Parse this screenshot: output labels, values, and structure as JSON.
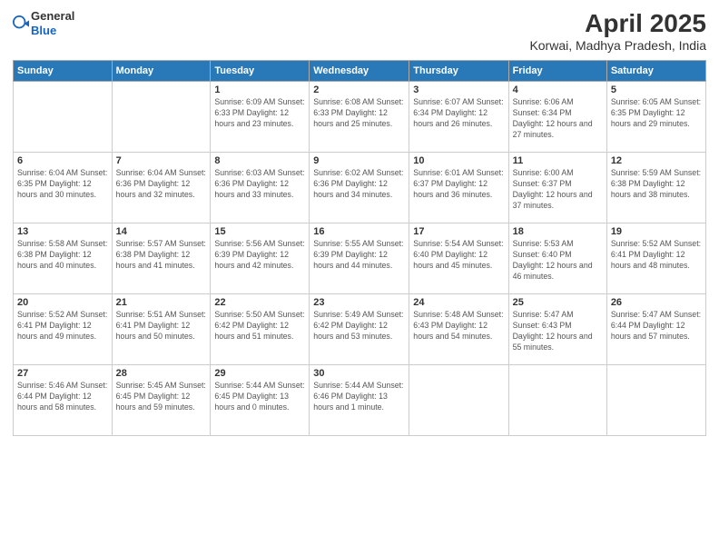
{
  "header": {
    "logo_general": "General",
    "logo_blue": "Blue",
    "month_title": "April 2025",
    "location": "Korwai, Madhya Pradesh, India"
  },
  "days_of_week": [
    "Sunday",
    "Monday",
    "Tuesday",
    "Wednesday",
    "Thursday",
    "Friday",
    "Saturday"
  ],
  "weeks": [
    [
      {
        "day": "",
        "info": ""
      },
      {
        "day": "",
        "info": ""
      },
      {
        "day": "1",
        "info": "Sunrise: 6:09 AM\nSunset: 6:33 PM\nDaylight: 12 hours and 23 minutes."
      },
      {
        "day": "2",
        "info": "Sunrise: 6:08 AM\nSunset: 6:33 PM\nDaylight: 12 hours and 25 minutes."
      },
      {
        "day": "3",
        "info": "Sunrise: 6:07 AM\nSunset: 6:34 PM\nDaylight: 12 hours and 26 minutes."
      },
      {
        "day": "4",
        "info": "Sunrise: 6:06 AM\nSunset: 6:34 PM\nDaylight: 12 hours and 27 minutes."
      },
      {
        "day": "5",
        "info": "Sunrise: 6:05 AM\nSunset: 6:35 PM\nDaylight: 12 hours and 29 minutes."
      }
    ],
    [
      {
        "day": "6",
        "info": "Sunrise: 6:04 AM\nSunset: 6:35 PM\nDaylight: 12 hours and 30 minutes."
      },
      {
        "day": "7",
        "info": "Sunrise: 6:04 AM\nSunset: 6:36 PM\nDaylight: 12 hours and 32 minutes."
      },
      {
        "day": "8",
        "info": "Sunrise: 6:03 AM\nSunset: 6:36 PM\nDaylight: 12 hours and 33 minutes."
      },
      {
        "day": "9",
        "info": "Sunrise: 6:02 AM\nSunset: 6:36 PM\nDaylight: 12 hours and 34 minutes."
      },
      {
        "day": "10",
        "info": "Sunrise: 6:01 AM\nSunset: 6:37 PM\nDaylight: 12 hours and 36 minutes."
      },
      {
        "day": "11",
        "info": "Sunrise: 6:00 AM\nSunset: 6:37 PM\nDaylight: 12 hours and 37 minutes."
      },
      {
        "day": "12",
        "info": "Sunrise: 5:59 AM\nSunset: 6:38 PM\nDaylight: 12 hours and 38 minutes."
      }
    ],
    [
      {
        "day": "13",
        "info": "Sunrise: 5:58 AM\nSunset: 6:38 PM\nDaylight: 12 hours and 40 minutes."
      },
      {
        "day": "14",
        "info": "Sunrise: 5:57 AM\nSunset: 6:38 PM\nDaylight: 12 hours and 41 minutes."
      },
      {
        "day": "15",
        "info": "Sunrise: 5:56 AM\nSunset: 6:39 PM\nDaylight: 12 hours and 42 minutes."
      },
      {
        "day": "16",
        "info": "Sunrise: 5:55 AM\nSunset: 6:39 PM\nDaylight: 12 hours and 44 minutes."
      },
      {
        "day": "17",
        "info": "Sunrise: 5:54 AM\nSunset: 6:40 PM\nDaylight: 12 hours and 45 minutes."
      },
      {
        "day": "18",
        "info": "Sunrise: 5:53 AM\nSunset: 6:40 PM\nDaylight: 12 hours and 46 minutes."
      },
      {
        "day": "19",
        "info": "Sunrise: 5:52 AM\nSunset: 6:41 PM\nDaylight: 12 hours and 48 minutes."
      }
    ],
    [
      {
        "day": "20",
        "info": "Sunrise: 5:52 AM\nSunset: 6:41 PM\nDaylight: 12 hours and 49 minutes."
      },
      {
        "day": "21",
        "info": "Sunrise: 5:51 AM\nSunset: 6:41 PM\nDaylight: 12 hours and 50 minutes."
      },
      {
        "day": "22",
        "info": "Sunrise: 5:50 AM\nSunset: 6:42 PM\nDaylight: 12 hours and 51 minutes."
      },
      {
        "day": "23",
        "info": "Sunrise: 5:49 AM\nSunset: 6:42 PM\nDaylight: 12 hours and 53 minutes."
      },
      {
        "day": "24",
        "info": "Sunrise: 5:48 AM\nSunset: 6:43 PM\nDaylight: 12 hours and 54 minutes."
      },
      {
        "day": "25",
        "info": "Sunrise: 5:47 AM\nSunset: 6:43 PM\nDaylight: 12 hours and 55 minutes."
      },
      {
        "day": "26",
        "info": "Sunrise: 5:47 AM\nSunset: 6:44 PM\nDaylight: 12 hours and 57 minutes."
      }
    ],
    [
      {
        "day": "27",
        "info": "Sunrise: 5:46 AM\nSunset: 6:44 PM\nDaylight: 12 hours and 58 minutes."
      },
      {
        "day": "28",
        "info": "Sunrise: 5:45 AM\nSunset: 6:45 PM\nDaylight: 12 hours and 59 minutes."
      },
      {
        "day": "29",
        "info": "Sunrise: 5:44 AM\nSunset: 6:45 PM\nDaylight: 13 hours and 0 minutes."
      },
      {
        "day": "30",
        "info": "Sunrise: 5:44 AM\nSunset: 6:46 PM\nDaylight: 13 hours and 1 minute."
      },
      {
        "day": "",
        "info": ""
      },
      {
        "day": "",
        "info": ""
      },
      {
        "day": "",
        "info": ""
      }
    ]
  ]
}
